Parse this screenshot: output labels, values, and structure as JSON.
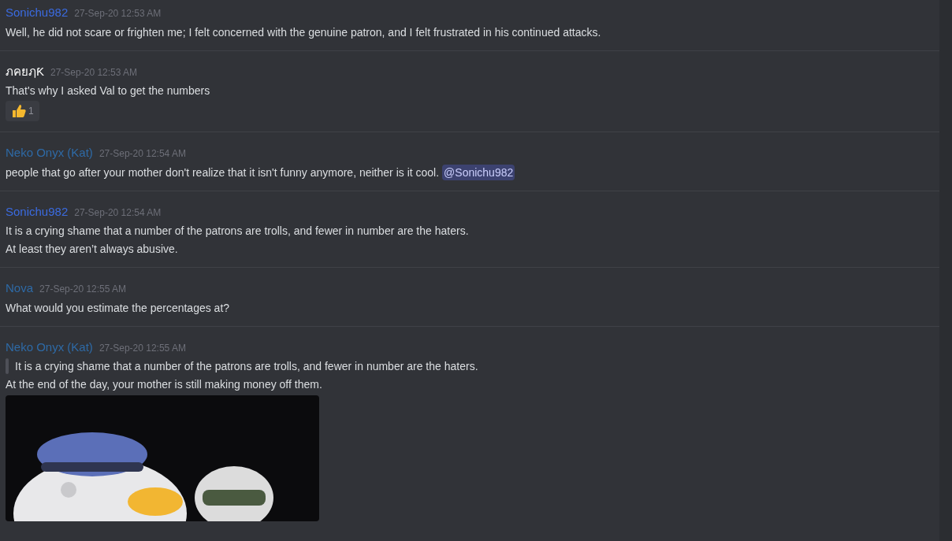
{
  "messages": [
    {
      "author": "Sonichu982",
      "color": "#3b6be0",
      "time": "27-Sep-20 12:53 AM",
      "lines": [
        "Well, he did not scare or frighten me; I felt concerned with the genuine patron, and I felt frustrated in his continued attacks."
      ]
    },
    {
      "author": "ภคยฦƘ",
      "color": "#ffffff",
      "time": "27-Sep-20 12:53 AM",
      "lines": [
        "That's why I asked Val to get the numbers"
      ],
      "reaction": {
        "count": "1"
      }
    },
    {
      "author": "Neko Onyx (Kat)",
      "color": "#2e6aa6",
      "time": "27-Sep-20 12:54 AM",
      "lines": [
        "people that go after your mother don't realize that it isn't funny anymore, neither is it cool."
      ],
      "mention": "@Sonichu982"
    },
    {
      "author": "Sonichu982",
      "color": "#3b6be0",
      "time": "27-Sep-20 12:54 AM",
      "lines": [
        "It is a crying shame that a number of the patrons are trolls, and fewer in number are the haters.",
        "At least they aren’t always abusive."
      ]
    },
    {
      "author": "Nova",
      "color": "#2e6aa6",
      "time": "27-Sep-20 12:55 AM",
      "lines": [
        "What would you estimate the percentages at?"
      ]
    },
    {
      "author": "Neko Onyx (Kat)",
      "color": "#2e6aa6",
      "time": "27-Sep-20 12:55 AM",
      "quote": "It is a crying shame that a number of the patrons are trolls, and fewer in number are the haters.",
      "lines": [
        "At the end of the day, your mother is still making money off them."
      ],
      "attachment": {
        "kind": "picture"
      }
    }
  ]
}
